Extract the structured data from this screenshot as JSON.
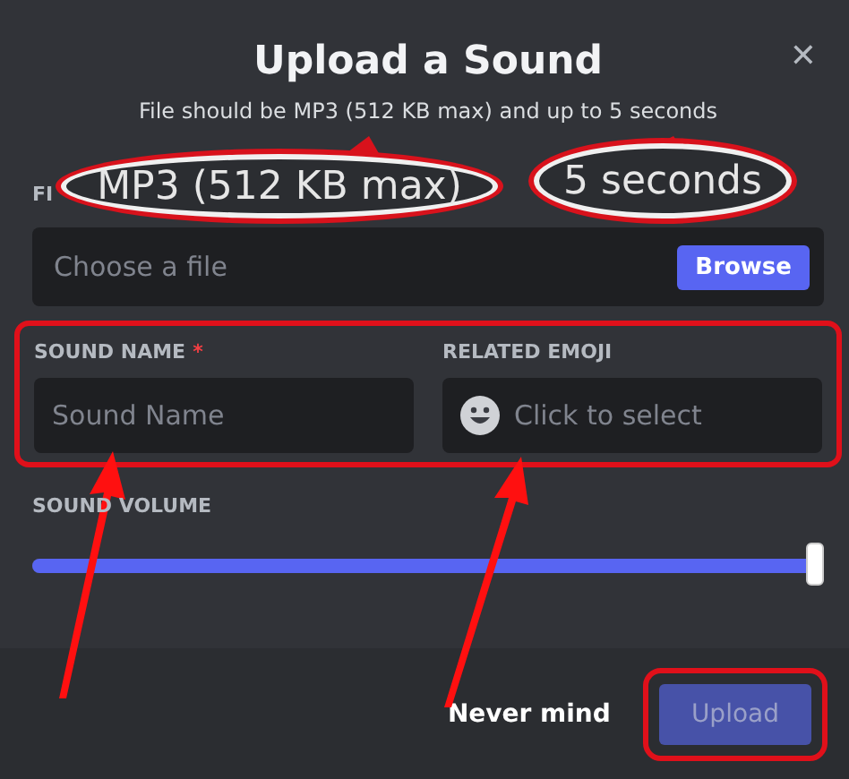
{
  "dialog": {
    "title": "Upload a Sound",
    "close_icon": "✕",
    "subtitle": "File should be MP3 (512 KB max) and up to 5 seconds"
  },
  "callouts": [
    {
      "text": "MP3 (512 KB max)"
    },
    {
      "text": "5 seconds"
    }
  ],
  "file": {
    "label": "FI",
    "placeholder": "Choose a file",
    "button": "Browse"
  },
  "sound_name": {
    "label": "SOUND NAME",
    "required_mark": "*",
    "placeholder": "Sound Name",
    "highlighted": true
  },
  "related_emoji": {
    "label": "RELATED EMOJI",
    "placeholder": "Click to select"
  },
  "volume": {
    "label": "SOUND VOLUME",
    "level": 1.0
  },
  "footer": {
    "cancel": "Never mind",
    "upload": {
      "label": "Upload",
      "disabled": true,
      "highlighted": true
    }
  }
}
